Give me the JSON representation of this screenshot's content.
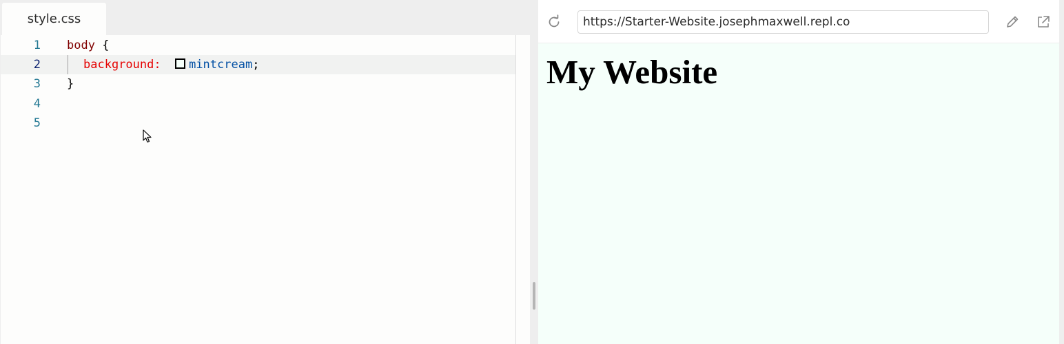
{
  "editor": {
    "tab_label": "style.css",
    "lines": [
      {
        "number": "1"
      },
      {
        "number": "2"
      },
      {
        "number": "3"
      },
      {
        "number": "4"
      },
      {
        "number": "5"
      }
    ],
    "code": {
      "selector": "body",
      "open_brace": " {",
      "property": "background:",
      "value": "mintcream",
      "semicolon": ";",
      "close_brace": "}"
    },
    "swatch_color": "#f5fffa"
  },
  "preview": {
    "url": "https://Starter-Website.josephmaxwell.repl.co",
    "heading": "My Website",
    "background_color": "#f5fffa"
  },
  "icons": {
    "refresh": "refresh-icon",
    "edit": "pencil-icon",
    "open_external": "external-link-icon",
    "cursor": "mouse-pointer-icon"
  }
}
